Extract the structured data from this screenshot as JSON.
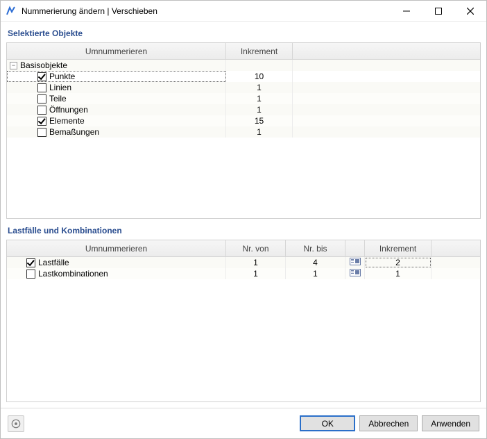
{
  "window": {
    "title": "Nummerierung ändern | Verschieben"
  },
  "section1": {
    "title": "Selektierte Objekte",
    "headers": {
      "name": "Umnummerieren",
      "increment": "Inkrement"
    },
    "root": {
      "label": "Basisobjekte"
    },
    "rows": [
      {
        "label": "Punkte",
        "checked": true,
        "increment": "10",
        "selected": true
      },
      {
        "label": "Linien",
        "checked": false,
        "increment": "1"
      },
      {
        "label": "Teile",
        "checked": false,
        "increment": "1"
      },
      {
        "label": "Öffnungen",
        "checked": false,
        "increment": "1"
      },
      {
        "label": "Elemente",
        "checked": true,
        "increment": "15"
      },
      {
        "label": "Bemaßungen",
        "checked": false,
        "increment": "1"
      }
    ]
  },
  "section2": {
    "title": "Lastfälle und Kombinationen",
    "headers": {
      "name": "Umnummerieren",
      "from": "Nr. von",
      "to": "Nr. bis",
      "increment": "Inkrement"
    },
    "rows": [
      {
        "label": "Lastfälle",
        "checked": true,
        "from": "1",
        "to": "4",
        "increment": "2",
        "focus": true
      },
      {
        "label": "Lastkombinationen",
        "checked": false,
        "from": "1",
        "to": "1",
        "increment": "1"
      }
    ]
  },
  "buttons": {
    "ok": "OK",
    "cancel": "Abbrechen",
    "apply": "Anwenden"
  }
}
